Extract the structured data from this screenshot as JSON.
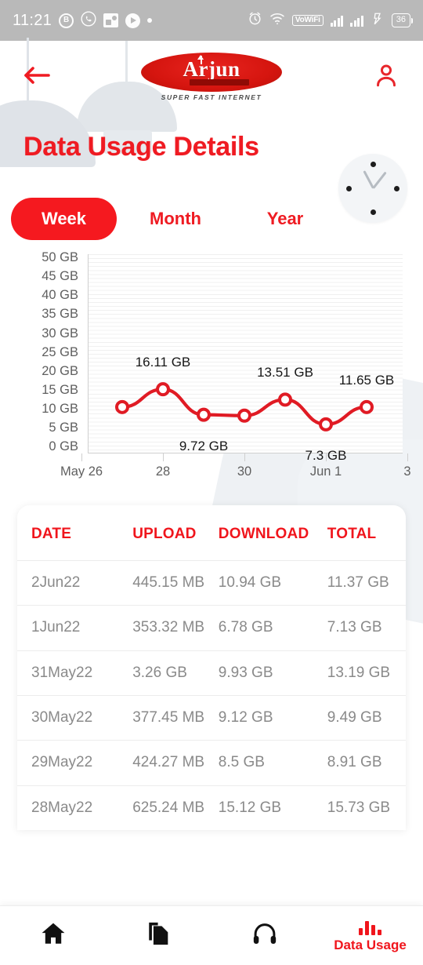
{
  "statusbar": {
    "time": "11:21",
    "left_icons": [
      "bitcoin-badge-icon",
      "whatsapp-icon",
      "photo-icon",
      "play-icon",
      "dot-icon"
    ],
    "vowifi_label": "VoWiFi",
    "battery_level": "36",
    "right_icons": [
      "alarm-icon",
      "wifi-icon",
      "vowifi-badge",
      "signal-icon",
      "signal-icon",
      "vibrate-icon",
      "battery-icon"
    ]
  },
  "header": {
    "back_icon": "arrow-left-icon",
    "profile_icon": "person-icon",
    "logo_word": "Arjun",
    "logo_tagline": "SUPER FAST INTERNET"
  },
  "page": {
    "title": "Data Usage Details",
    "accent_color": "#ef1b22",
    "active_tab": "Week"
  },
  "tabs": [
    {
      "label": "Week",
      "active": true
    },
    {
      "label": "Month",
      "active": false
    },
    {
      "label": "Year",
      "active": false
    }
  ],
  "chart_data": {
    "type": "line",
    "title": "Data Usage Details",
    "xlabel": "",
    "ylabel": "",
    "ylim": [
      0,
      50
    ],
    "yunit": "GB",
    "grid": true,
    "legend": false,
    "line_color": "#e01b24",
    "marker": "open-circle",
    "ytick_labels": [
      "50 GB",
      "45 GB",
      "40 GB",
      "35 GB",
      "30 GB",
      "25 GB",
      "20 GB",
      "15 GB",
      "10 GB",
      "5 GB",
      "0 GB"
    ],
    "ytick_values": [
      50,
      45,
      40,
      35,
      30,
      25,
      20,
      15,
      10,
      5,
      0
    ],
    "xtick_labels": [
      "May 26",
      "28",
      "30",
      "Jun 1",
      "3"
    ],
    "xtick_values": [
      26,
      28,
      30,
      32,
      34
    ],
    "x": [
      "May 27",
      "May 28",
      "May 29",
      "May 30",
      "May 31",
      "Jun 1",
      "Jun 2"
    ],
    "categories": [
      "27",
      "28",
      "29",
      "30",
      "31",
      "1",
      "2"
    ],
    "values": [
      11.65,
      16.11,
      9.72,
      9.49,
      13.51,
      7.3,
      11.65
    ],
    "point_labels": [
      {
        "text": "16.11 GB",
        "index": 1,
        "position": "above"
      },
      {
        "text": "13.51 GB",
        "index": 4,
        "position": "above"
      },
      {
        "text": "11.65 GB",
        "index": 6,
        "position": "above"
      },
      {
        "text": "9.72 GB",
        "index": 2,
        "position": "below"
      },
      {
        "text": "7.3 GB",
        "index": 5,
        "position": "below"
      }
    ]
  },
  "table": {
    "headers": [
      "DATE",
      "UPLOAD",
      "DOWNLOAD",
      "TOTAL"
    ],
    "rows": [
      {
        "date": "2Jun22",
        "upload": "445.15 MB",
        "download": "10.94 GB",
        "total": "11.37 GB"
      },
      {
        "date": "1Jun22",
        "upload": "353.32 MB",
        "download": "6.78 GB",
        "total": "7.13 GB"
      },
      {
        "date": "31May22",
        "upload": "3.26 GB",
        "download": "9.93 GB",
        "total": "13.19 GB"
      },
      {
        "date": "30May22",
        "upload": "377.45 MB",
        "download": "9.12 GB",
        "total": "9.49 GB"
      },
      {
        "date": "29May22",
        "upload": "424.27 MB",
        "download": "8.5 GB",
        "total": "8.91 GB"
      },
      {
        "date": "28May22",
        "upload": "625.24 MB",
        "download": "15.12 GB",
        "total": "15.73 GB"
      }
    ]
  },
  "bottomnav": {
    "items": [
      {
        "icon": "home-icon",
        "label": "",
        "active": false
      },
      {
        "icon": "documents-icon",
        "label": "",
        "active": false
      },
      {
        "icon": "headphones-icon",
        "label": "",
        "active": false
      },
      {
        "icon": "bar-chart-icon",
        "label": "Data Usage",
        "active": true
      }
    ]
  }
}
